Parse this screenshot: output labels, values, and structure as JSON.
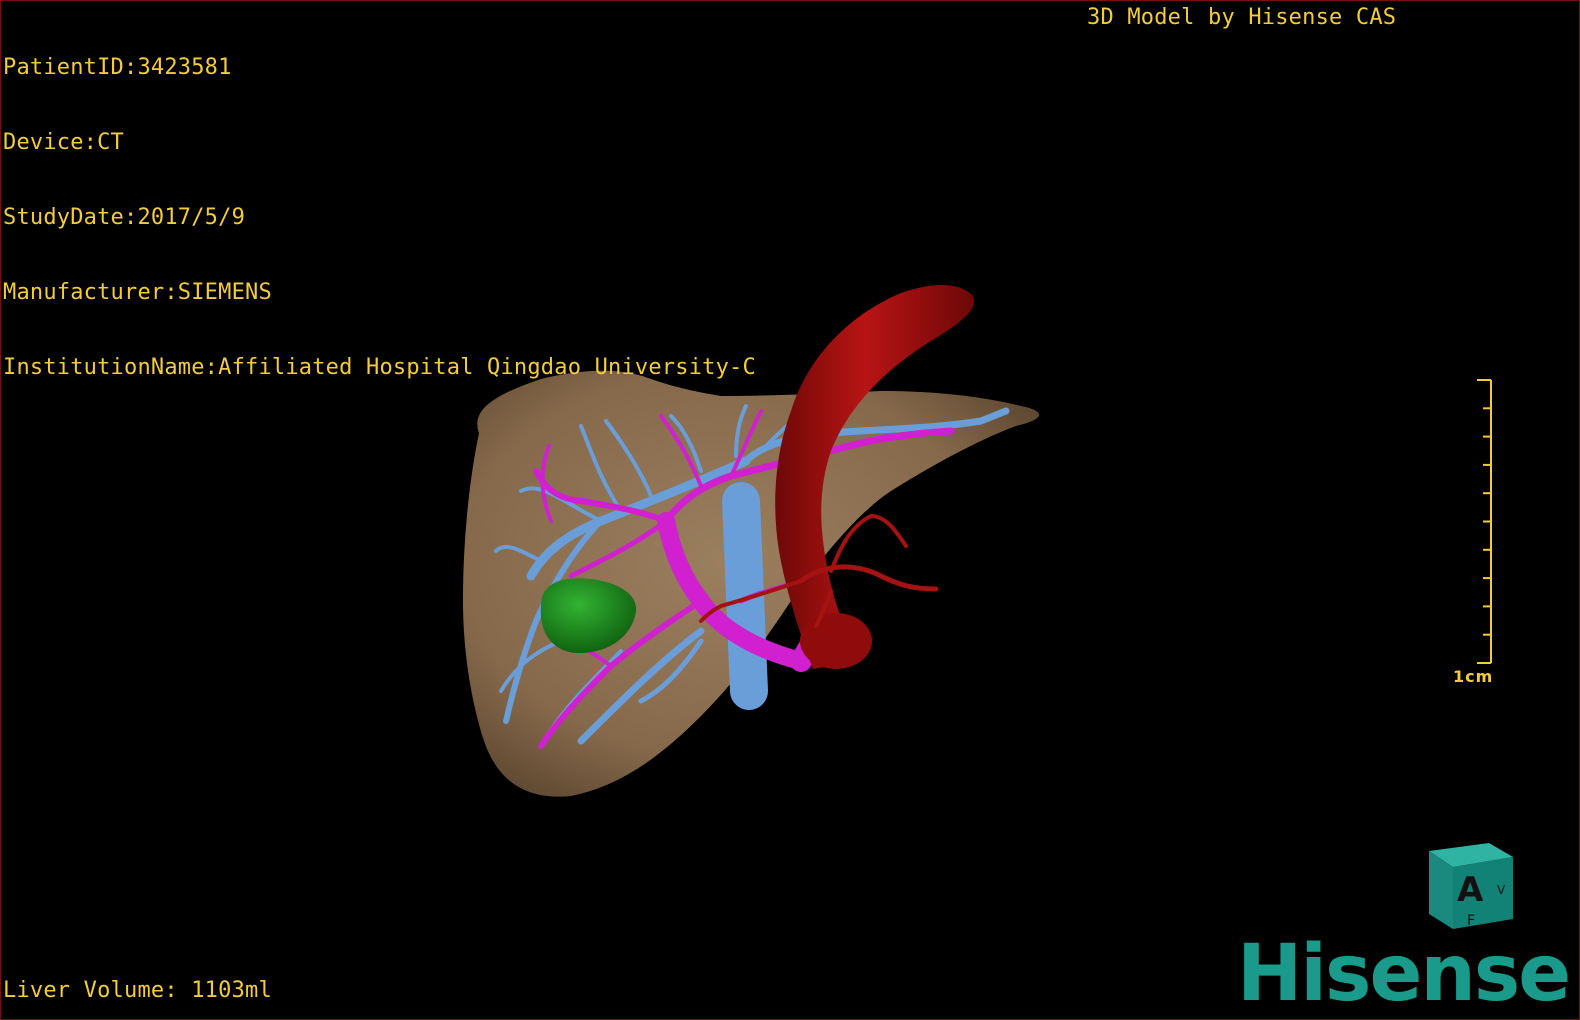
{
  "overlay": {
    "patient_id": "PatientID:3423581",
    "device": "Device:CT",
    "study_date": "StudyDate:2017/5/9",
    "manufacturer": "Manufacturer:SIEMENS",
    "institution": "InstitutionName:Affiliated Hospital Qingdao University-C",
    "credit": "3D Model by Hisense CAS",
    "liver_volume": "Liver Volume: 1103ml"
  },
  "scale": {
    "label": "1cm",
    "ticks": 10
  },
  "orientation_cube": {
    "face_front": "A",
    "face_bottom": "F",
    "face_right": "V",
    "color": "#1a8a7e"
  },
  "logo": {
    "text": "Hisense",
    "color": "#1a9a8a"
  },
  "colors": {
    "overlay_text": "#f2cc3a",
    "liver": "#8c7153",
    "aorta": "#a01010",
    "portal_vein": "#d020d0",
    "hepatic_vein": "#6a9ed8",
    "gallbladder": "#1e8c1e",
    "frame_border": "#7a0f0f"
  },
  "icons": [
    "orientation-cube-icon",
    "scale-bar-icon"
  ]
}
